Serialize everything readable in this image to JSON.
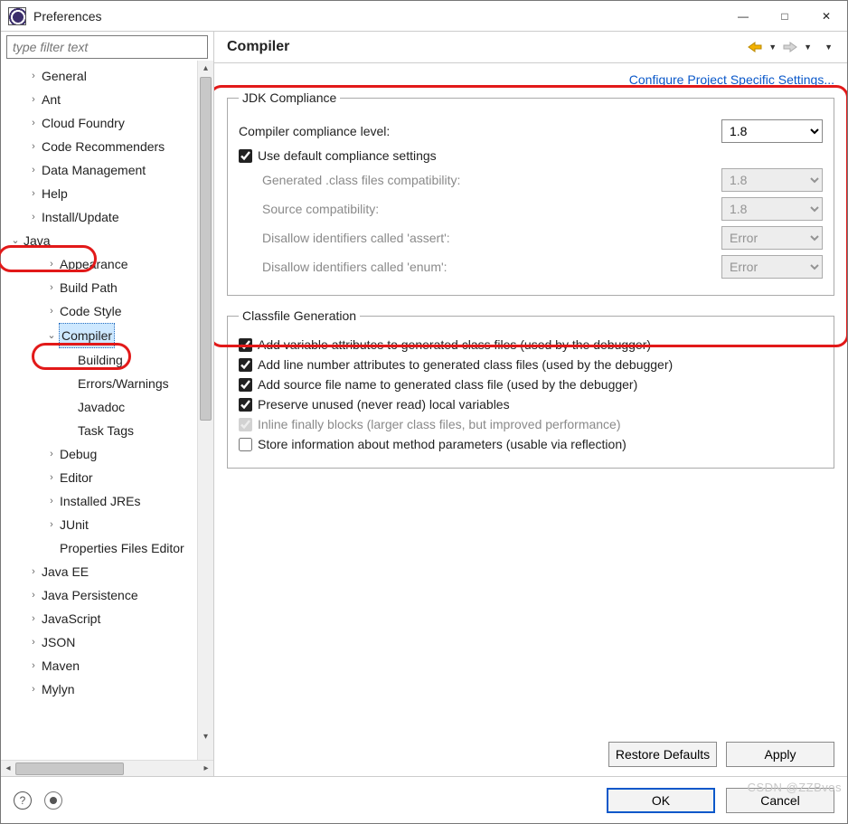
{
  "window": {
    "title": "Preferences"
  },
  "sidebar": {
    "filter_placeholder": "type filter text",
    "items": [
      {
        "label": "General",
        "indent": 1,
        "exp": ">"
      },
      {
        "label": "Ant",
        "indent": 1,
        "exp": ">"
      },
      {
        "label": "Cloud Foundry",
        "indent": 1,
        "exp": ">"
      },
      {
        "label": "Code Recommenders",
        "indent": 1,
        "exp": ">"
      },
      {
        "label": "Data Management",
        "indent": 1,
        "exp": ">"
      },
      {
        "label": "Help",
        "indent": 1,
        "exp": ">"
      },
      {
        "label": "Install/Update",
        "indent": 1,
        "exp": ">"
      },
      {
        "label": "Java",
        "indent": 0,
        "exp": "v"
      },
      {
        "label": "Appearance",
        "indent": 2,
        "exp": ">"
      },
      {
        "label": "Build Path",
        "indent": 2,
        "exp": ">"
      },
      {
        "label": "Code Style",
        "indent": 2,
        "exp": ">"
      },
      {
        "label": "Compiler",
        "indent": 2,
        "exp": "v",
        "selected": true
      },
      {
        "label": "Building",
        "indent": 3,
        "exp": ""
      },
      {
        "label": "Errors/Warnings",
        "indent": 3,
        "exp": ""
      },
      {
        "label": "Javadoc",
        "indent": 3,
        "exp": ""
      },
      {
        "label": "Task Tags",
        "indent": 3,
        "exp": ""
      },
      {
        "label": "Debug",
        "indent": 2,
        "exp": ">"
      },
      {
        "label": "Editor",
        "indent": 2,
        "exp": ">"
      },
      {
        "label": "Installed JREs",
        "indent": 2,
        "exp": ">"
      },
      {
        "label": "JUnit",
        "indent": 2,
        "exp": ">"
      },
      {
        "label": "Properties Files Editor",
        "indent": 2,
        "exp": ""
      },
      {
        "label": "Java EE",
        "indent": 1,
        "exp": ">"
      },
      {
        "label": "Java Persistence",
        "indent": 1,
        "exp": ">"
      },
      {
        "label": "JavaScript",
        "indent": 1,
        "exp": ">"
      },
      {
        "label": "JSON",
        "indent": 1,
        "exp": ">"
      },
      {
        "label": "Maven",
        "indent": 1,
        "exp": ">"
      },
      {
        "label": "Mylyn",
        "indent": 1,
        "exp": ">"
      }
    ]
  },
  "main": {
    "title": "Compiler",
    "config_link": "Configure Project Specific Settings...",
    "jdk": {
      "legend": "JDK Compliance",
      "compliance_label": "Compiler compliance level:",
      "compliance_value": "1.8",
      "use_default_label": "Use default compliance settings",
      "use_default_checked": true,
      "gen_class_label": "Generated .class files compatibility:",
      "gen_class_value": "1.8",
      "source_label": "Source compatibility:",
      "source_value": "1.8",
      "assert_label": "Disallow identifiers called 'assert':",
      "assert_value": "Error",
      "enum_label": "Disallow identifiers called 'enum':",
      "enum_value": "Error"
    },
    "classfile": {
      "legend": "Classfile Generation",
      "add_var": {
        "label": "Add variable attributes to generated class files (used by the debugger)",
        "checked": true
      },
      "add_line": {
        "label": "Add line number attributes to generated class files (used by the debugger)",
        "checked": true
      },
      "add_src": {
        "label": "Add source file name to generated class file (used by the debugger)",
        "checked": true
      },
      "preserve": {
        "label": "Preserve unused (never read) local variables",
        "checked": true
      },
      "inline": {
        "label": "Inline finally blocks (larger class files, but improved performance)",
        "checked": true,
        "disabled": true
      },
      "store": {
        "label": "Store information about method parameters (usable via reflection)",
        "checked": false
      }
    },
    "buttons": {
      "restore": "Restore Defaults",
      "apply": "Apply",
      "ok": "OK",
      "cancel": "Cancel"
    }
  },
  "watermark": "CSDN @ZZBvos"
}
